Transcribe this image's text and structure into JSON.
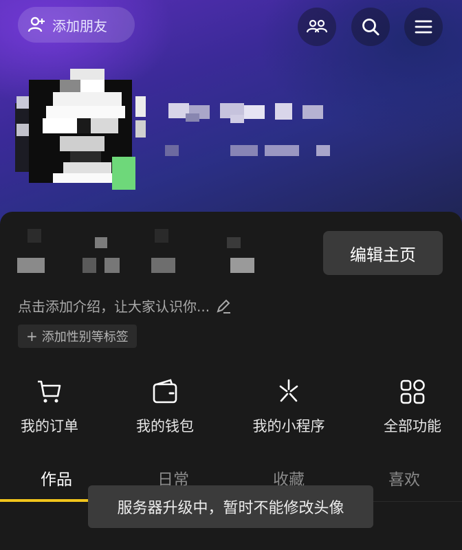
{
  "header": {
    "add_friend_label": "添加朋友",
    "icons": [
      "add-user-icon",
      "friends-icon",
      "search-icon",
      "menu-icon"
    ]
  },
  "profile": {
    "edit_button": "编辑主页",
    "intro_text": "点击添加介绍，让大家认识你...",
    "tag_button": "添加性别等标签"
  },
  "functions": [
    {
      "label": "我的订单",
      "icon": "cart-icon"
    },
    {
      "label": "我的钱包",
      "icon": "wallet-icon"
    },
    {
      "label": "我的小程序",
      "icon": "mini-program-icon"
    },
    {
      "label": "全部功能",
      "icon": "grid-icon"
    }
  ],
  "tabs": [
    {
      "label": "作品",
      "active": true
    },
    {
      "label": "日常",
      "active": false
    },
    {
      "label": "收藏",
      "active": false
    },
    {
      "label": "喜欢",
      "active": false
    }
  ],
  "toast": {
    "text": "服务器升级中，暂时不能修改头像"
  },
  "colors": {
    "accent": "#f2c51c",
    "panel": "#1a1a1a",
    "header_purple": "#5a2fb8"
  }
}
